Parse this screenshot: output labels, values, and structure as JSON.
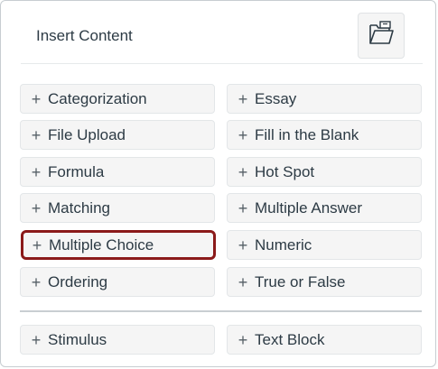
{
  "header": {
    "title": "Insert Content",
    "folder_icon": "folder-open-icon"
  },
  "plus_glyph": "+",
  "question_types": [
    {
      "label": "Categorization"
    },
    {
      "label": "Essay"
    },
    {
      "label": "File Upload"
    },
    {
      "label": "Fill in the Blank"
    },
    {
      "label": "Formula"
    },
    {
      "label": "Hot Spot"
    },
    {
      "label": "Matching"
    },
    {
      "label": "Multiple Answer"
    },
    {
      "label": "Multiple Choice",
      "selected": true
    },
    {
      "label": "Numeric"
    },
    {
      "label": "Ordering"
    },
    {
      "label": "True or False"
    }
  ],
  "content_blocks": [
    {
      "label": "Stimulus"
    },
    {
      "label": "Text Block"
    }
  ],
  "colors": {
    "selected_border": "#8b1a1a",
    "button_bg": "#f5f5f5",
    "text": "#2d3b45"
  }
}
